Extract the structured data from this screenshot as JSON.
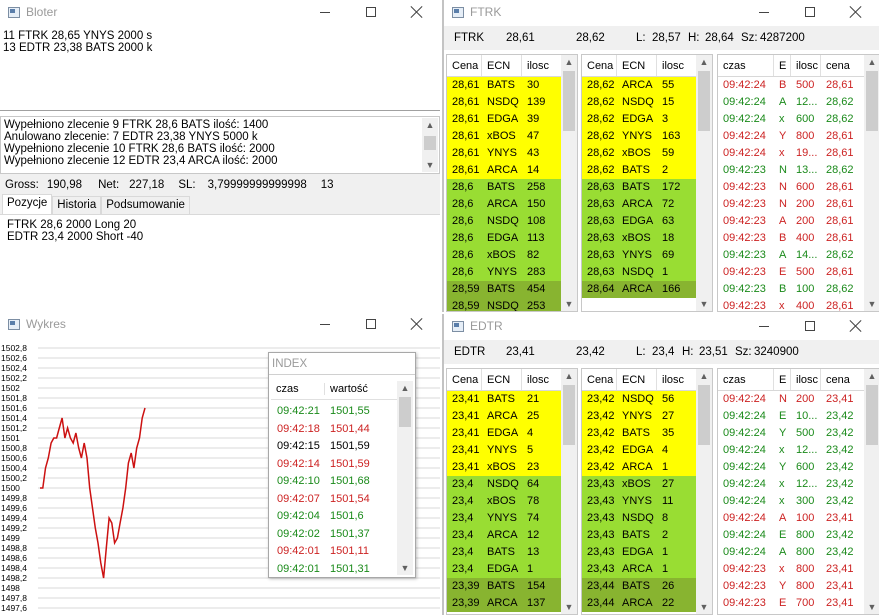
{
  "bloter": {
    "title": "Bloter",
    "orders": [
      "11 FTRK 28,65 YNYS 2000 s",
      "13 EDTR 23,38 BATS 2000 k"
    ],
    "log": [
      "Wypełniono zlecenie 9 FTRK 28,6 BATS ilość: 1400",
      "Anulowano zlecenie: 7 EDTR 23,38 YNYS 5000 k",
      "Wypełniono zlecenie 10 FTRK 28,6 BATS ilość: 2000",
      "Wypełniono zlecenie 12 EDTR 23,4 ARCA ilość: 2000"
    ],
    "gross_label": "Gross:",
    "gross": "190,98",
    "net_label": "Net:",
    "net": "227,18",
    "sl_label": "SL:",
    "sl": "3,79999999999998",
    "count": "13",
    "tabs": [
      "Pozycje",
      "Historia",
      "Podsumowanie"
    ],
    "positions": [
      "FTRK 28,6 2000 Long 20",
      "EDTR 23,4 2000 Short -40"
    ]
  },
  "wykres": {
    "title": "Wykres",
    "y_ticks": [
      "1502,8",
      "1502,6",
      "1502,4",
      "1502,2",
      "1502",
      "1501,8",
      "1501,6",
      "1501,4",
      "1501,2",
      "1501",
      "1500,8",
      "1500,6",
      "1500,4",
      "1500,2",
      "1500",
      "1499,8",
      "1499,6",
      "1499,4",
      "1499,2",
      "1499",
      "1498,8",
      "1498,6",
      "1498,4",
      "1498,2",
      "1498",
      "1497,8",
      "1497,6"
    ],
    "index": {
      "title": "INDEX",
      "col_czas": "czas",
      "col_wartosc": "wartość",
      "rows": [
        {
          "czas": "09:42:21",
          "wartosc": "1501,55",
          "c": "grn"
        },
        {
          "czas": "09:42:18",
          "wartosc": "1501,44",
          "c": "red"
        },
        {
          "czas": "09:42:15",
          "wartosc": "1501,59",
          "c": "blk"
        },
        {
          "czas": "09:42:14",
          "wartosc": "1501,59",
          "c": "red"
        },
        {
          "czas": "09:42:10",
          "wartosc": "1501,68",
          "c": "grn"
        },
        {
          "czas": "09:42:07",
          "wartosc": "1501,54",
          "c": "red"
        },
        {
          "czas": "09:42:04",
          "wartosc": "1501,6",
          "c": "grn"
        },
        {
          "czas": "09:42:02",
          "wartosc": "1501,37",
          "c": "grn"
        },
        {
          "czas": "09:42:01",
          "wartosc": "1501,11",
          "c": "red"
        },
        {
          "czas": "09:42:01",
          "wartosc": "1501,31",
          "c": "grn"
        }
      ]
    },
    "chart_data": {
      "type": "line",
      "ylim": [
        1497.6,
        1502.8
      ],
      "series": [
        {
          "values": [
            1500.0,
            1500.0,
            1500.4,
            1500.6,
            1500.9,
            1501.0,
            1501.0,
            1501.2,
            1501.4,
            1501.0,
            1501.2,
            1501.0,
            1500.9,
            1501.1,
            1500.8,
            1500.6,
            1500.9,
            1500.6,
            1500.0,
            1499.6,
            1499.2,
            1498.9,
            1498.5,
            1498.2,
            1498.8,
            1499.4,
            1499.3,
            1498.9,
            1499.0,
            1499.3,
            1499.6,
            1500.0,
            1500.5,
            1500.7,
            1500.4,
            1500.8,
            1501.0,
            1501.4,
            1501.6
          ]
        }
      ]
    }
  },
  "ftrk": {
    "title": "FTRK",
    "symbol": "FTRK",
    "bid": "28,61",
    "ask": "28,62",
    "l_label": "L:",
    "low": "28,57",
    "h_label": "H:",
    "high": "28,64",
    "sz_label": "Sz:",
    "vol": "4287200",
    "bid_cols": [
      "Cena",
      "ECN",
      "ilosc"
    ],
    "bids": [
      [
        "28,61",
        "BATS",
        "30",
        "y"
      ],
      [
        "28,61",
        "NSDQ",
        "139",
        "y"
      ],
      [
        "28,61",
        "EDGA",
        "39",
        "y"
      ],
      [
        "28,61",
        "xBOS",
        "47",
        "y"
      ],
      [
        "28,61",
        "YNYS",
        "43",
        "y"
      ],
      [
        "28,61",
        "ARCA",
        "14",
        "y"
      ],
      [
        "28,6",
        "BATS",
        "258",
        "g"
      ],
      [
        "28,6",
        "ARCA",
        "150",
        "g"
      ],
      [
        "28,6",
        "NSDQ",
        "108",
        "g"
      ],
      [
        "28,6",
        "EDGA",
        "113",
        "g"
      ],
      [
        "28,6",
        "xBOS",
        "82",
        "g"
      ],
      [
        "28,6",
        "YNYS",
        "283",
        "g"
      ],
      [
        "28,59",
        "BATS",
        "454",
        "dg"
      ],
      [
        "28,59",
        "NSDQ",
        "253",
        "dg"
      ]
    ],
    "asks": [
      [
        "28,62",
        "ARCA",
        "55",
        "y"
      ],
      [
        "28,62",
        "NSDQ",
        "15",
        "y"
      ],
      [
        "28,62",
        "EDGA",
        "3",
        "y"
      ],
      [
        "28,62",
        "YNYS",
        "163",
        "y"
      ],
      [
        "28,62",
        "xBOS",
        "59",
        "y"
      ],
      [
        "28,62",
        "BATS",
        "2",
        "y"
      ],
      [
        "28,63",
        "BATS",
        "172",
        "g"
      ],
      [
        "28,63",
        "ARCA",
        "72",
        "g"
      ],
      [
        "28,63",
        "EDGA",
        "63",
        "g"
      ],
      [
        "28,63",
        "xBOS",
        "18",
        "g"
      ],
      [
        "28,63",
        "YNYS",
        "69",
        "g"
      ],
      [
        "28,63",
        "NSDQ",
        "1",
        "g"
      ],
      [
        "28,64",
        "ARCA",
        "166",
        "dg"
      ]
    ],
    "trade_cols": [
      "czas",
      "E",
      "ilosc",
      "cena"
    ],
    "trades": [
      [
        "09:42:24",
        "B",
        "500",
        "28,61",
        "red"
      ],
      [
        "09:42:24",
        "A",
        "12...",
        "28,62",
        "grn"
      ],
      [
        "09:42:24",
        "x",
        "600",
        "28,62",
        "grn"
      ],
      [
        "09:42:24",
        "Y",
        "800",
        "28,61",
        "red"
      ],
      [
        "09:42:24",
        "x",
        "19...",
        "28,61",
        "red"
      ],
      [
        "09:42:23",
        "N",
        "13...",
        "28,62",
        "grn"
      ],
      [
        "09:42:23",
        "N",
        "600",
        "28,61",
        "red"
      ],
      [
        "09:42:23",
        "N",
        "200",
        "28,61",
        "red"
      ],
      [
        "09:42:23",
        "A",
        "200",
        "28,61",
        "red"
      ],
      [
        "09:42:23",
        "B",
        "400",
        "28,61",
        "red"
      ],
      [
        "09:42:23",
        "A",
        "14...",
        "28,62",
        "grn"
      ],
      [
        "09:42:23",
        "E",
        "500",
        "28,61",
        "red"
      ],
      [
        "09:42:23",
        "B",
        "100",
        "28,62",
        "grn"
      ],
      [
        "09:42:23",
        "x",
        "400",
        "28,61",
        "red"
      ]
    ]
  },
  "edtr": {
    "title": "EDTR",
    "symbol": "EDTR",
    "bid": "23,41",
    "ask": "23,42",
    "l_label": "L:",
    "low": "23,4",
    "h_label": "H:",
    "high": "23,51",
    "sz_label": "Sz:",
    "vol": "3240900",
    "bid_cols": [
      "Cena",
      "ECN",
      "ilosc"
    ],
    "bids": [
      [
        "23,41",
        "BATS",
        "21",
        "y"
      ],
      [
        "23,41",
        "ARCA",
        "25",
        "y"
      ],
      [
        "23,41",
        "EDGA",
        "4",
        "y"
      ],
      [
        "23,41",
        "YNYS",
        "5",
        "y"
      ],
      [
        "23,41",
        "xBOS",
        "23",
        "y"
      ],
      [
        "23,4",
        "NSDQ",
        "64",
        "g"
      ],
      [
        "23,4",
        "xBOS",
        "78",
        "g"
      ],
      [
        "23,4",
        "YNYS",
        "74",
        "g"
      ],
      [
        "23,4",
        "ARCA",
        "12",
        "g"
      ],
      [
        "23,4",
        "BATS",
        "13",
        "g"
      ],
      [
        "23,4",
        "EDGA",
        "1",
        "g"
      ],
      [
        "23,39",
        "BATS",
        "154",
        "dg"
      ],
      [
        "23,39",
        "ARCA",
        "137",
        "dg"
      ]
    ],
    "asks": [
      [
        "23,42",
        "NSDQ",
        "56",
        "y"
      ],
      [
        "23,42",
        "YNYS",
        "27",
        "y"
      ],
      [
        "23,42",
        "BATS",
        "35",
        "y"
      ],
      [
        "23,42",
        "EDGA",
        "4",
        "y"
      ],
      [
        "23,42",
        "ARCA",
        "1",
        "y"
      ],
      [
        "23,43",
        "xBOS",
        "27",
        "g"
      ],
      [
        "23,43",
        "YNYS",
        "11",
        "g"
      ],
      [
        "23,43",
        "NSDQ",
        "8",
        "g"
      ],
      [
        "23,43",
        "BATS",
        "2",
        "g"
      ],
      [
        "23,43",
        "EDGA",
        "1",
        "g"
      ],
      [
        "23,43",
        "ARCA",
        "1",
        "g"
      ],
      [
        "23,44",
        "BATS",
        "26",
        "dg"
      ],
      [
        "23,44",
        "ARCA",
        "22",
        "dg"
      ]
    ],
    "trade_cols": [
      "czas",
      "E",
      "ilosc",
      "cena"
    ],
    "trades": [
      [
        "09:42:24",
        "N",
        "200",
        "23,41",
        "red"
      ],
      [
        "09:42:24",
        "E",
        "10...",
        "23,42",
        "grn"
      ],
      [
        "09:42:24",
        "Y",
        "500",
        "23,42",
        "grn"
      ],
      [
        "09:42:24",
        "x",
        "12...",
        "23,42",
        "grn"
      ],
      [
        "09:42:24",
        "Y",
        "600",
        "23,42",
        "grn"
      ],
      [
        "09:42:24",
        "x",
        "12...",
        "23,42",
        "grn"
      ],
      [
        "09:42:24",
        "x",
        "300",
        "23,42",
        "grn"
      ],
      [
        "09:42:24",
        "A",
        "100",
        "23,41",
        "red"
      ],
      [
        "09:42:24",
        "E",
        "800",
        "23,42",
        "grn"
      ],
      [
        "09:42:24",
        "A",
        "800",
        "23,42",
        "grn"
      ],
      [
        "09:42:23",
        "x",
        "800",
        "23,41",
        "red"
      ],
      [
        "09:42:23",
        "Y",
        "800",
        "23,41",
        "red"
      ],
      [
        "09:42:23",
        "E",
        "700",
        "23,41",
        "red"
      ],
      [
        "09:42:23",
        "E",
        "200",
        "23,42",
        "grn"
      ]
    ]
  }
}
